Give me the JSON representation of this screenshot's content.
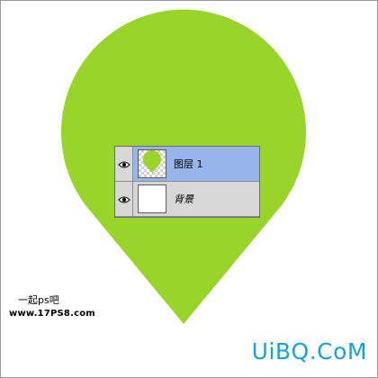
{
  "canvas": {
    "pin_color": "#99d42a",
    "background": "#ffffff"
  },
  "layers_panel": {
    "layers": [
      {
        "label": "图层 1",
        "selected": true,
        "visible": true,
        "thumbnail": "transparent-with-green-pin"
      },
      {
        "label": "背景",
        "selected": false,
        "visible": true,
        "thumbnail": "white"
      }
    ],
    "selected_color": "#98b5ea"
  },
  "watermark_left": {
    "line1": "一起ps吧",
    "line2": "www.17PS8.com"
  },
  "watermark_right": {
    "text": "UiBQ.CoM",
    "color": "#1aa0d8"
  }
}
